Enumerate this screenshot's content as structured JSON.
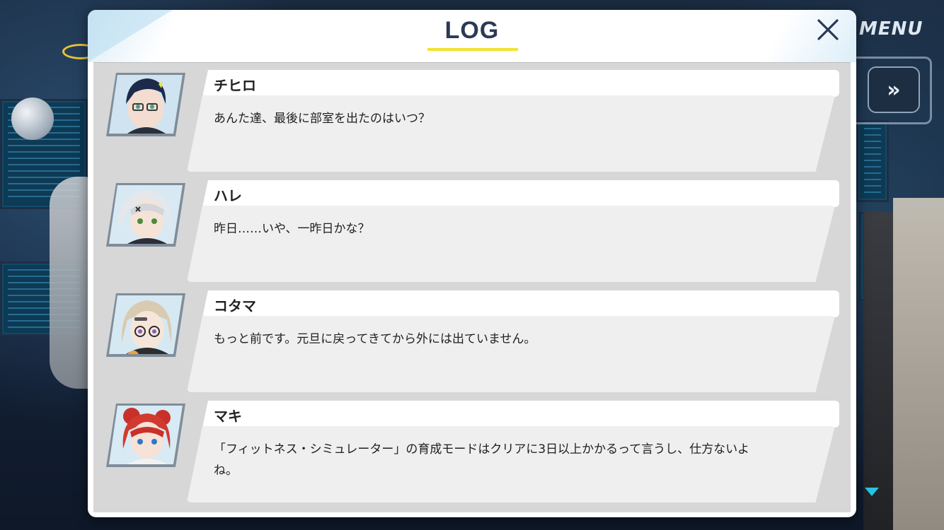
{
  "app": {
    "menu_label": "MENU",
    "fast_forward_label": "»"
  },
  "log": {
    "title": "LOG",
    "entries": [
      {
        "name": "チヒロ",
        "text": "あんた達、最後に部室を出たのはいつ？",
        "avatar": "chihiro-portrait"
      },
      {
        "name": "ハレ",
        "text": "昨日……いや、一昨日かな？",
        "avatar": "hare-portrait"
      },
      {
        "name": "コタマ",
        "text": "もっと前です。元旦に戻ってきてから外には出ていません。",
        "avatar": "kotama-portrait"
      },
      {
        "name": "マキ",
        "text": "「フィットネス・シミュレーター」の育成モードはクリアに3日以上かかるって言うし、仕方ないよね。",
        "avatar": "maki-portrait"
      }
    ]
  },
  "colors": {
    "accent_yellow": "#f3e22f",
    "title_color": "#2a3a55",
    "log_bg": "#d7d7d7",
    "scroll_indicator": "#25c5e0"
  }
}
